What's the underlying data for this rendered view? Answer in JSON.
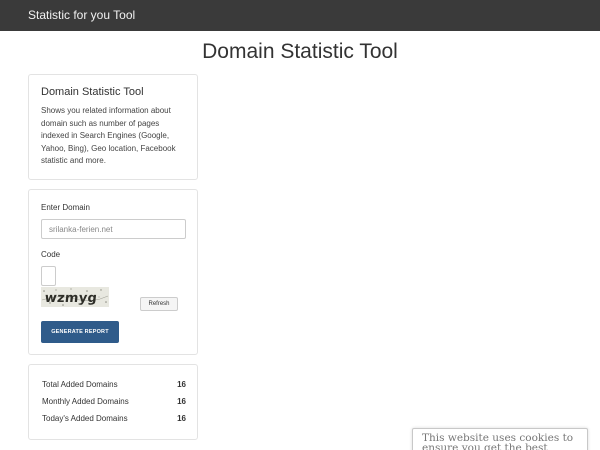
{
  "navbar": {
    "brand": "Statistic for you Tool"
  },
  "page": {
    "title": "Domain Statistic Tool"
  },
  "about": {
    "title": "Domain Statistic Tool",
    "description": "Shows you related information about domain such as number of pages indexed in Search Engines (Google, Yahoo, Bing), Geo location, Facebook statistic and more."
  },
  "form": {
    "domain_label": "Enter Domain",
    "domain_placeholder": "srilanka-ferien.net",
    "code_label": "Code",
    "captcha_text": "wzmyg",
    "refresh_label": "Refresh",
    "generate_label": "GENERATE REPORT",
    "generate_color": "#2f5b8a"
  },
  "stats": [
    {
      "label": "Total Added Domains",
      "value": "16"
    },
    {
      "label": "Monthly Added Domains",
      "value": "16"
    },
    {
      "label": "Today's Added Domains",
      "value": "16"
    }
  ],
  "cookie": {
    "text": "This website uses cookies to ensure you get the best"
  },
  "colors": {
    "navbar": "#3a3a3a",
    "accent": "#2f5b8a"
  }
}
